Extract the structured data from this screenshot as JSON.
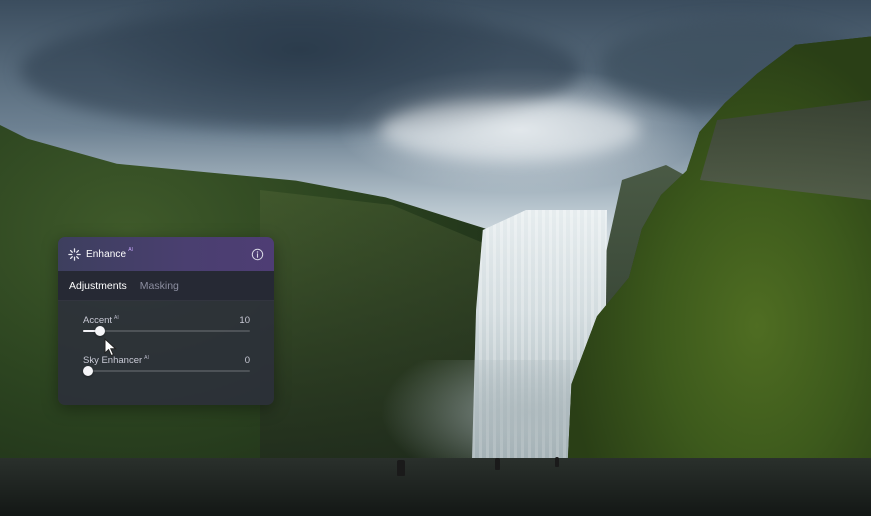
{
  "panel": {
    "title": "Enhance",
    "title_badge": "AI",
    "icons": {
      "title_icon": "sparkle-icon",
      "info": "info-icon"
    },
    "tabs": [
      {
        "label": "Adjustments",
        "active": true
      },
      {
        "label": "Masking",
        "active": false
      }
    ],
    "sliders": [
      {
        "label": "Accent",
        "badge": "AI",
        "value": "10",
        "level": 0.1
      },
      {
        "label": "Sky Enhancer",
        "badge": "AI",
        "value": "0",
        "level": 0
      }
    ]
  },
  "colors": {
    "panel_background": "#2c2e3c",
    "header_gradient_start": "#3d3f5e",
    "header_gradient_end": "#4e3d74",
    "ai_badge": "#c9a7ff",
    "slider_fill": "#f2f2f6"
  },
  "cursor": "arrow-cursor-icon"
}
